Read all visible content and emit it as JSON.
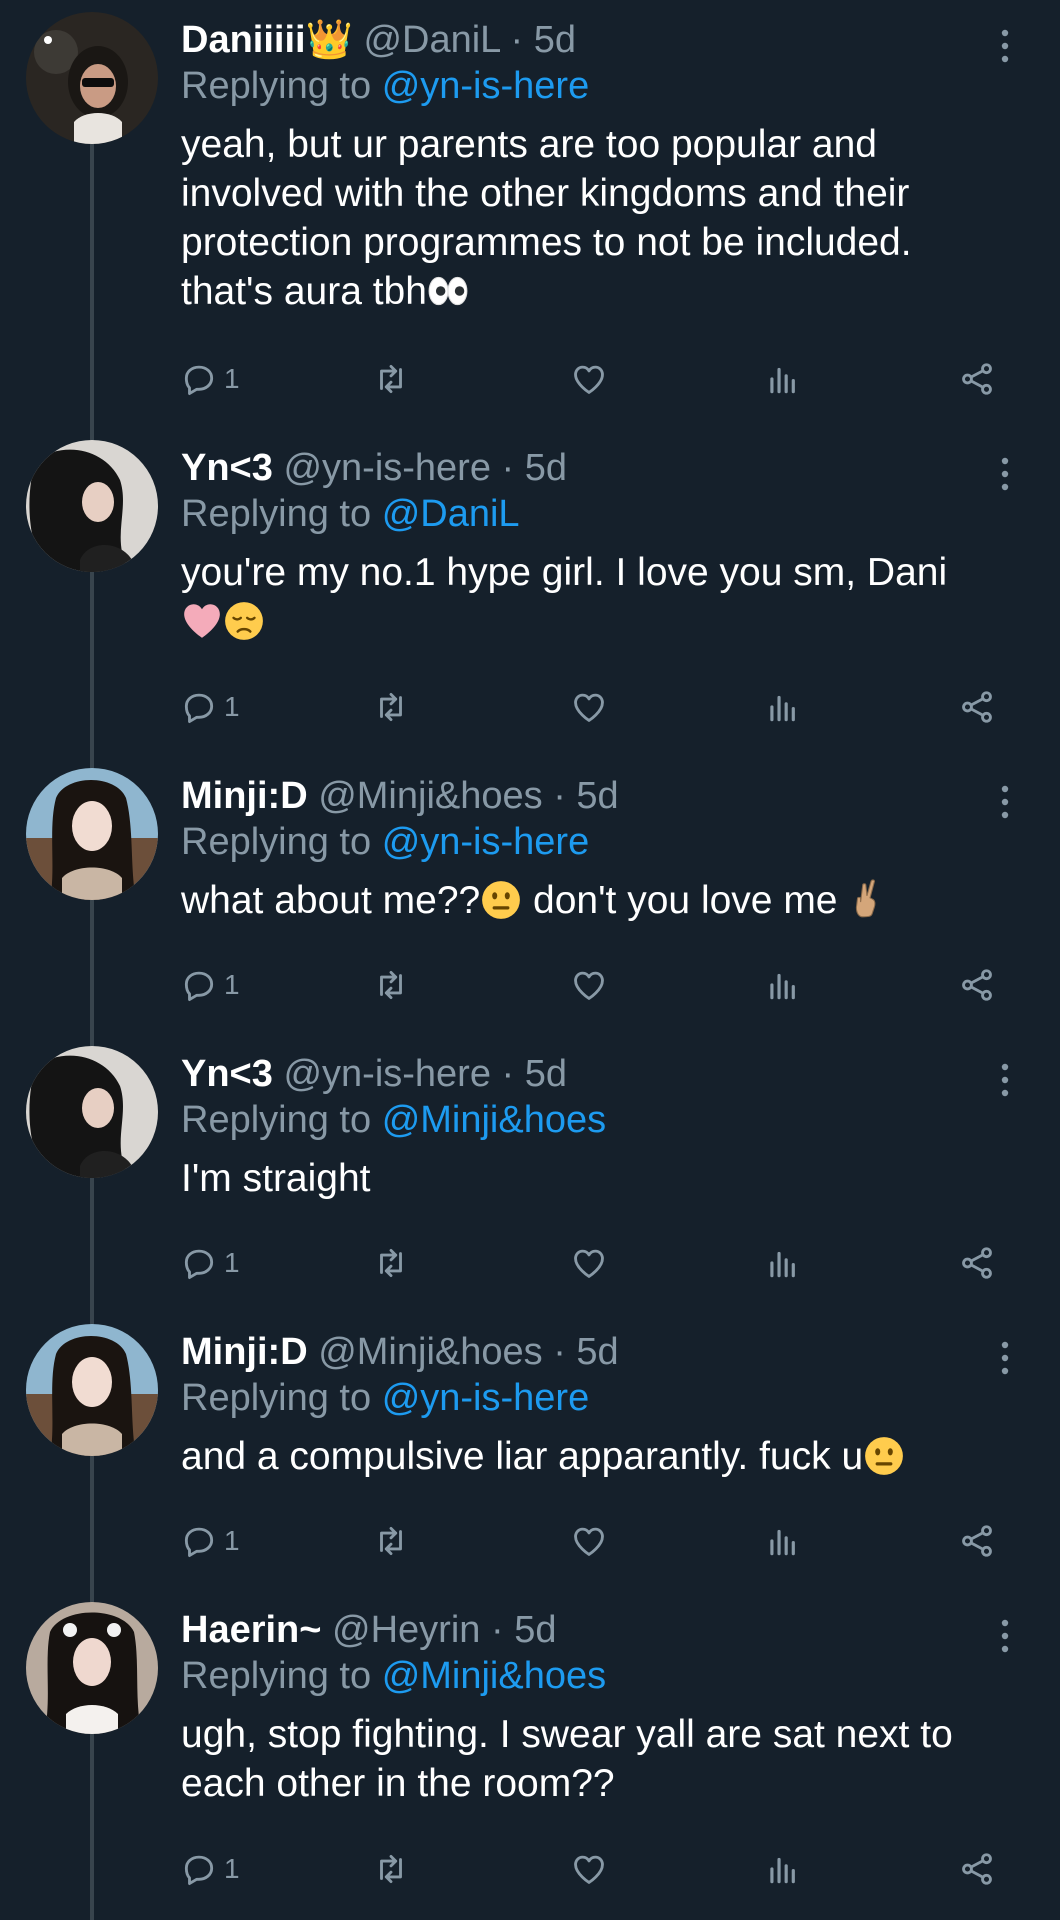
{
  "reply_prefix": "Replying to",
  "colors": {
    "background": "#15202b",
    "muted": "#8899a6",
    "mention": "#1d9bf0",
    "thread_line": "#38444d"
  },
  "tweets": [
    {
      "name": "Daniiiii👑",
      "handle": "@DaniL",
      "time": "5d",
      "reply_to": "@yn-is-here",
      "text": "yeah, but ur parents are too popular and involved with the other kingdoms and their protection programmes to not be included. that's aura tbh",
      "emojis": [
        "eyes-emoji"
      ],
      "reply_count": "1"
    },
    {
      "name": "Yn<3",
      "handle": "@yn-is-here",
      "time": "5d",
      "reply_to": "@DaniL",
      "text": "you're my no.1 hype girl. I love you sm, Dani",
      "emojis": [
        "pink-heart-emoji",
        "disappointed-face-emoji"
      ],
      "reply_count": "1"
    },
    {
      "name": "Minji:D",
      "handle": "@Minji&hoes",
      "time": "5d",
      "reply_to": "@yn-is-here",
      "text_a": "what about me??",
      "text_b": " don't you love me ",
      "emojis": [
        "neutral-face-emoji",
        "crossed-fingers-emoji"
      ],
      "reply_count": "1"
    },
    {
      "name": "Yn<3",
      "handle": "@yn-is-here",
      "time": "5d",
      "reply_to": "@Minji&hoes",
      "text": "I'm straight",
      "emojis": [],
      "reply_count": "1"
    },
    {
      "name": "Minji:D",
      "handle": "@Minji&hoes",
      "time": "5d",
      "reply_to": "@yn-is-here",
      "text": "and a compulsive liar apparantly. fuck u",
      "emojis": [
        "neutral-face-emoji"
      ],
      "reply_count": "1"
    },
    {
      "name": "Haerin~",
      "handle": "@Heyrin",
      "time": "5d",
      "reply_to": "@Minji&hoes",
      "text": "ugh, stop fighting. I swear yall are sat next to each other in the room??",
      "emojis": [],
      "reply_count": "1"
    }
  ],
  "action_icons": [
    "reply-icon",
    "retweet-icon",
    "like-icon",
    "analytics-icon",
    "share-icon"
  ]
}
